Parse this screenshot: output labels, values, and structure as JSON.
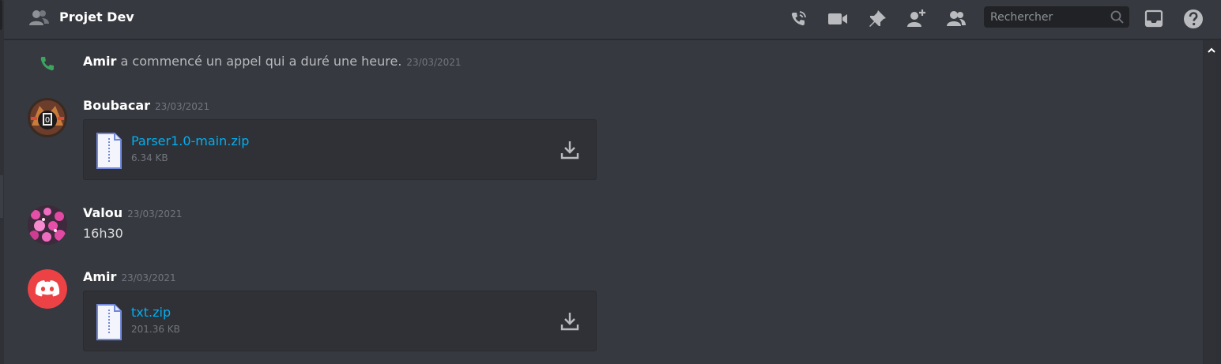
{
  "header": {
    "title": "Projet Dev",
    "search_placeholder": "Rechercher",
    "icons": [
      "group-dm-icon",
      "start-voice-call-icon",
      "start-video-call-icon",
      "pinned-messages-icon",
      "add-friends-to-dm-icon",
      "member-list-icon",
      "search-icon",
      "inbox-icon",
      "help-icon"
    ]
  },
  "call_event": {
    "name": "Amir",
    "text": " a commencé un appel qui a duré une heure.",
    "timestamp": "23/03/2021"
  },
  "messages": [
    {
      "author": "Boubacar",
      "timestamp": "23/03/2021",
      "attachment": {
        "file_name": "Parser1.0-main.zip",
        "file_size": "6.34 KB"
      }
    },
    {
      "author": "Valou",
      "timestamp": "23/03/2021",
      "text": "16h30"
    },
    {
      "author": "Amir",
      "timestamp": "23/03/2021",
      "attachment": {
        "file_name": "txt.zip",
        "file_size": "201.36 KB"
      }
    }
  ],
  "colors": {
    "background": "#36393f",
    "header_text": "#ffffff",
    "link": "#00b0f4",
    "call_green": "#3ba55d",
    "discord_red": "#ed4245"
  }
}
